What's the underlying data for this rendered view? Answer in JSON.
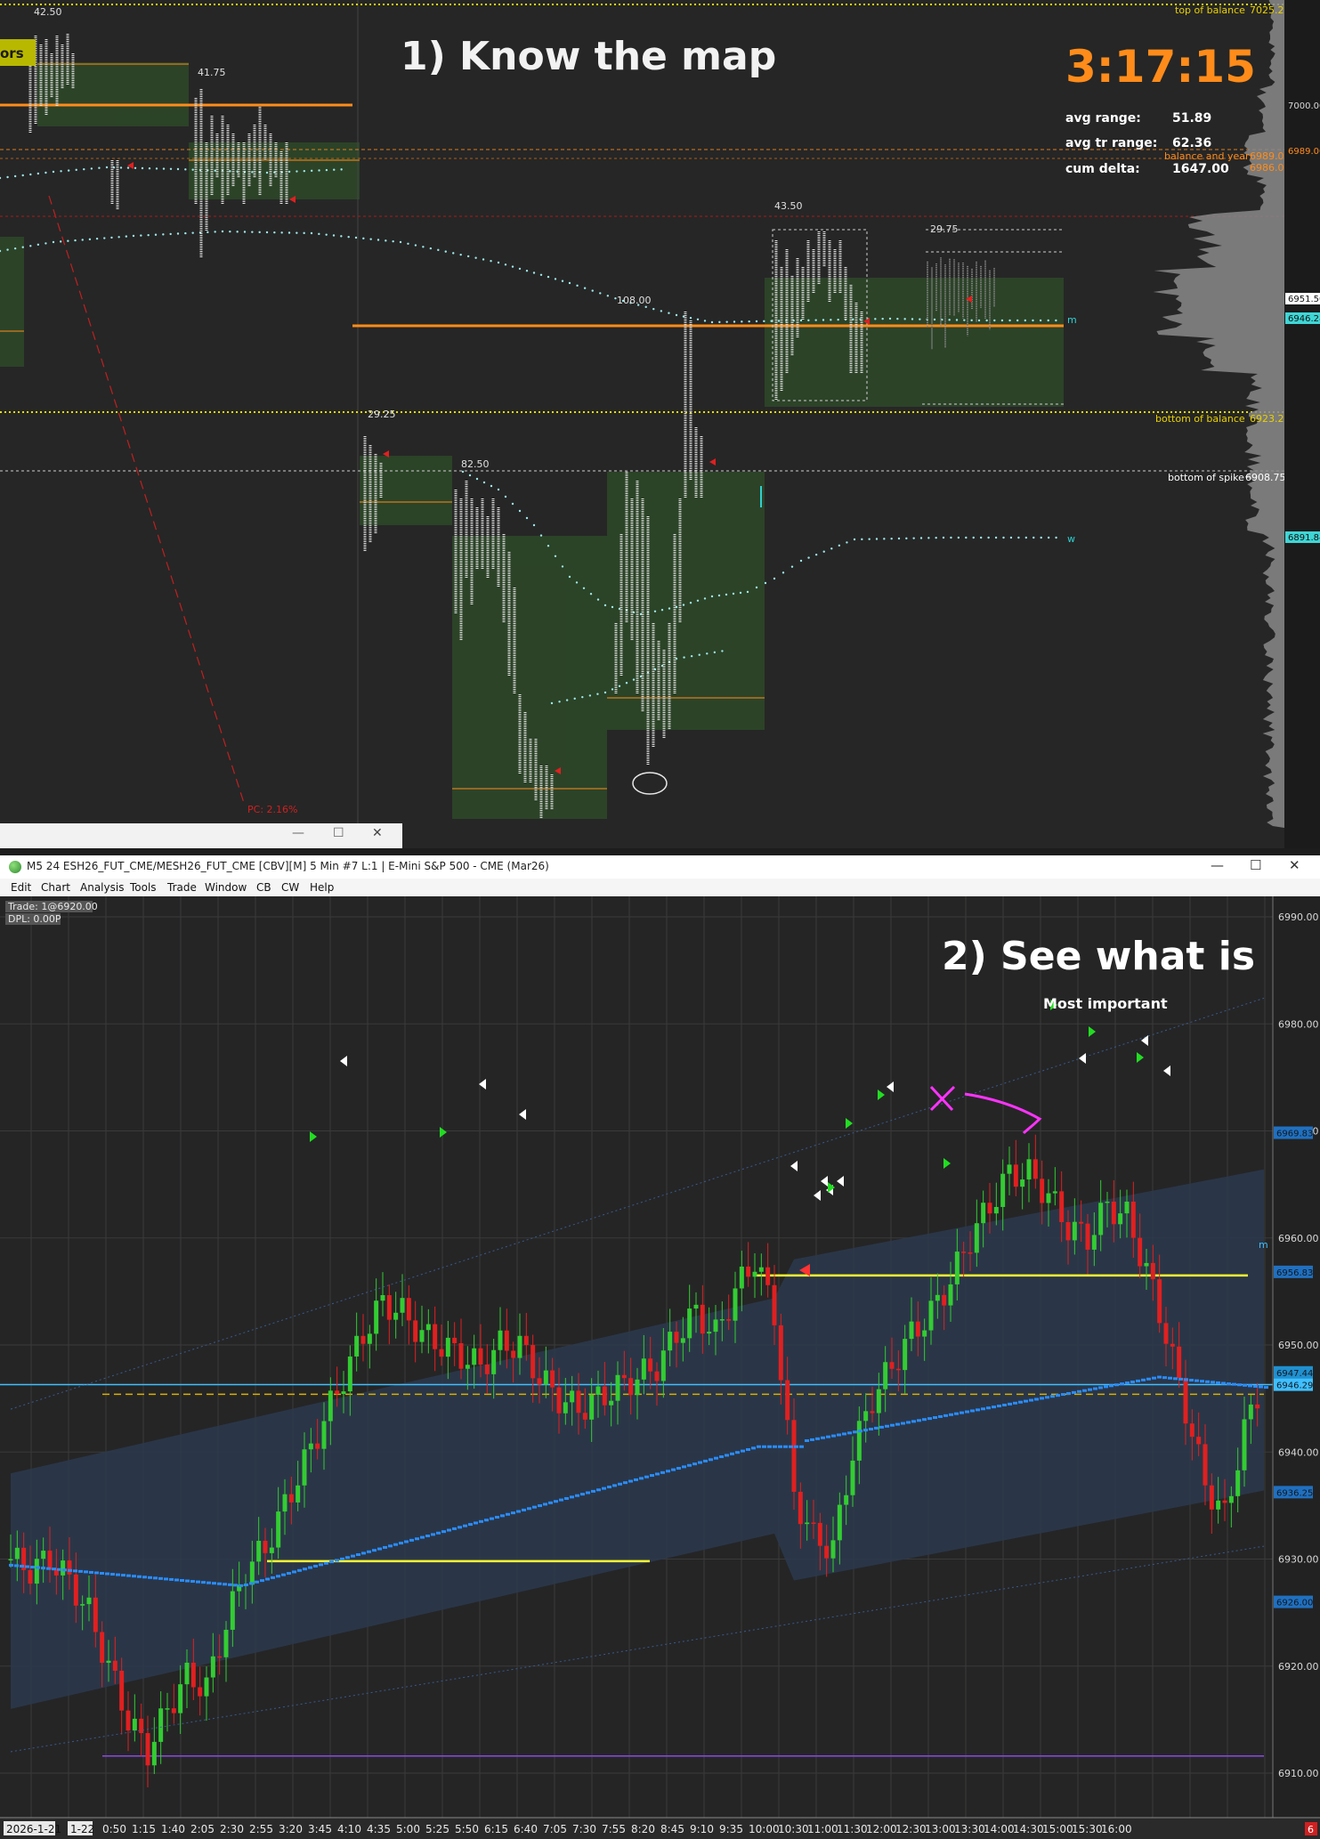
{
  "top_chart": {
    "title": "1)  Know the map",
    "timer": "3:17:15",
    "stats": [
      {
        "label": "avg range:",
        "value": "51.89"
      },
      {
        "label": "avg tr range:",
        "value": "62.36"
      },
      {
        "label": "cum delta:",
        "value": "1647.00"
      }
    ],
    "corner_label": "ors",
    "range_labels": [
      "42.50",
      "41.75",
      "43.50",
      "29.75",
      "108.00",
      "29.25",
      "82.50"
    ],
    "level_labels": {
      "top_of_balance": "top of balance",
      "top_of_balance_price": "7025.25",
      "balance_and_year": "balance and year",
      "balance_and_year_price": "6989.00",
      "price_6986": "6986.00",
      "bottom_of_balance": "bottom of balance",
      "bottom_of_balance_price": "6923.25",
      "bottom_of_spike": "bottom of spike",
      "bottom_of_spike_price": "6908.75"
    },
    "price_axis": {
      "p7000": "7000.00",
      "p6989": "6989.00",
      "p6951": "6951.50",
      "p6946": "6946.28",
      "p6891": "6891.84"
    },
    "pc_label": "PC: 2.16%",
    "marker_m": "m",
    "marker_w": "w",
    "colors": {
      "orange": "#ff8c1a",
      "yellow_dotted": "#e8e000",
      "value_area": "#2f4a2a",
      "vwap_dots": "#9fe8e8"
    }
  },
  "small_window": {
    "minimize_icon": "—",
    "maximize_icon": "☐",
    "close_icon": "✕"
  },
  "bottom_window": {
    "title": "M5 24 ESH26_FUT_CME/MESH26_FUT_CME [CBV][M]  5 Min  #7 L:1 | E-Mini S&P 500 - CME (Mar26)",
    "menu": [
      "Edit",
      "Chart",
      "Analysis",
      "Tools",
      "Trade",
      "Window",
      "CB",
      "CW",
      "Help"
    ],
    "trade_info": "Trade: 1@6920.00",
    "dpl_info": "DPL: 0.00P",
    "heading": "2)  See what is",
    "subheading": "Most important",
    "y_axis": [
      "6990.00",
      "6980.00",
      "6970.00",
      "6960.00",
      "6950.00",
      "6940.00",
      "6930.00",
      "6920.00",
      "6910.00"
    ],
    "y_tags": [
      "6969.83",
      "6956.83",
      "6947.44",
      "6946.29",
      "6936.25",
      "6926.00"
    ],
    "date_label": "2026-1-21",
    "date_label2": "1-22",
    "x_axis": [
      "0:50",
      "1:15",
      "1:40",
      "2:05",
      "2:30",
      "2:55",
      "3:20",
      "3:45",
      "4:10",
      "4:35",
      "5:00",
      "5:25",
      "5:50",
      "6:15",
      "6:40",
      "7:05",
      "7:30",
      "7:55",
      "8:20",
      "8:45",
      "9:10",
      "9:35",
      "10:00",
      "10:30",
      "11:00",
      "11:30",
      "12:00",
      "12:30",
      "13:00",
      "13:30",
      "14:00",
      "14:30",
      "15:00",
      "15:30",
      "16:00"
    ],
    "marker_m": "m",
    "badge": "6",
    "minimize_icon": "—",
    "maximize_icon": "☐",
    "close_icon": "✕"
  },
  "chart_data": {
    "type": "candlestick",
    "title": "2)  See what is",
    "timeframe": "5 Min",
    "ylim": [
      6908,
      6992
    ],
    "candles_close_approx": [
      6930,
      6929,
      6930,
      6928,
      6925,
      6920,
      6915,
      6912,
      6916,
      6919,
      6918,
      6924,
      6929,
      6931,
      6935,
      6939,
      6943,
      6947,
      6951,
      6954,
      6953,
      6951,
      6950,
      6949,
      6948,
      6950,
      6950,
      6947,
      6945,
      6944,
      6945,
      6946,
      6947,
      6948,
      6951,
      6953,
      6951,
      6955,
      6958,
      6953,
      6936,
      6932,
      6931,
      6940,
      6945,
      6948,
      6951,
      6953,
      6956,
      6960,
      6963,
      6966,
      6966,
      6964,
      6961,
      6960,
      6963,
      6962,
      6957,
      6951,
      6944,
      6937,
      6934,
      6942,
      6947
    ],
    "horizontal_lines": [
      {
        "price": 6956.5,
        "color": "#ffff33"
      },
      {
        "price": 6929.8,
        "color": "#ffff33"
      },
      {
        "price": 6945.4,
        "color": "#d8b000",
        "style": "dashed"
      },
      {
        "price": 6946.3,
        "color": "#3fbfff"
      },
      {
        "price": 6911.6,
        "color": "#8a4be0"
      }
    ]
  }
}
